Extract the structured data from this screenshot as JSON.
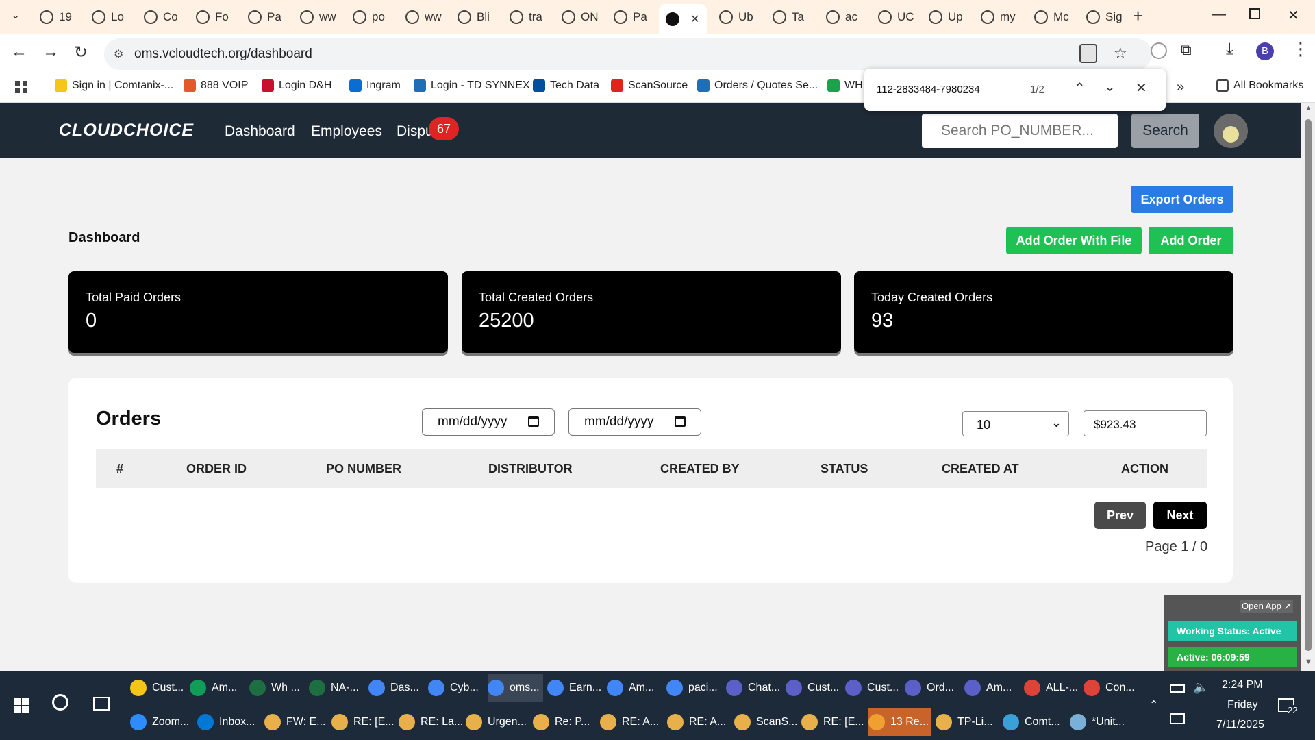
{
  "browser": {
    "tabs": [
      {
        "label": "19",
        "icon": "globe-icon"
      },
      {
        "label": "Lo",
        "icon": "globe-icon"
      },
      {
        "label": "Co",
        "icon": "logi-icon"
      },
      {
        "label": "Fo",
        "icon": "globe-icon"
      },
      {
        "label": "Pa",
        "icon": "arrow-icon"
      },
      {
        "label": "ww",
        "icon": "globe-icon"
      },
      {
        "label": "po",
        "icon": "doc-icon"
      },
      {
        "label": "ww",
        "icon": "globe-icon"
      },
      {
        "label": "Bli",
        "icon": "globe-icon"
      },
      {
        "label": "tra",
        "icon": "globe-icon"
      },
      {
        "label": "ON",
        "icon": "globe-icon"
      },
      {
        "label": "Pa",
        "icon": "cloud-icon"
      },
      {
        "label": "",
        "icon": "active-tab-icon"
      },
      {
        "label": "Ub",
        "icon": "u-icon"
      },
      {
        "label": "Ta",
        "icon": "globe-icon"
      },
      {
        "label": "ac",
        "icon": "globe-icon"
      },
      {
        "label": "UC",
        "icon": "uc-icon"
      },
      {
        "label": "Up",
        "icon": "check-icon"
      },
      {
        "label": "my",
        "icon": "globe-icon"
      },
      {
        "label": "Mc",
        "icon": "etn-icon"
      },
      {
        "label": "Sig",
        "icon": "globe-icon"
      }
    ],
    "url": "oms.vcloudtech.org/dashboard",
    "profile_initial": "B",
    "bookmarks": [
      {
        "label": "Sign in | Comtanix-...",
        "color": "#f5c518"
      },
      {
        "label": "888 VOIP",
        "color": "#e05a2a"
      },
      {
        "label": "Login D&H",
        "color": "#c8102e"
      },
      {
        "label": "Ingram",
        "color": "#0a6ed1"
      },
      {
        "label": "Login - TD SYNNEX",
        "color": "#1f6fb6"
      },
      {
        "label": "Tech Data",
        "color": "#0050a0"
      },
      {
        "label": "ScanSource",
        "color": "#e2231a"
      },
      {
        "label": "Orders / Quotes Se...",
        "color": "#1f6fb6"
      },
      {
        "label": "WH",
        "color": "#1aa34a"
      }
    ],
    "all_bookmarks": "All Bookmarks",
    "find": {
      "query": "112-2833484-7980234",
      "count": "1/2"
    }
  },
  "app": {
    "brand": "CLOUDCHOICE",
    "nav": [
      "Dashboard",
      "Employees",
      "Dispu"
    ],
    "badge": "67",
    "search_placeholder": "Search PO_NUMBER...",
    "search_label": "Search"
  },
  "dashboard": {
    "title": "Dashboard",
    "export_label": "Export Orders",
    "add_file_label": "Add Order With File",
    "add_label": "Add Order",
    "cards": [
      {
        "label": "Total Paid Orders",
        "value": "0"
      },
      {
        "label": "Total Created Orders",
        "value": "25200"
      },
      {
        "label": "Today Created Orders",
        "value": "93"
      }
    ]
  },
  "orders": {
    "title": "Orders",
    "date_placeholder": "mm/dd/yyyy",
    "page_size": "10",
    "amount": "$923.43",
    "columns": [
      "#",
      "ORDER ID",
      "PO NUMBER",
      "DISTRIBUTOR",
      "CREATED BY",
      "STATUS",
      "CREATED AT",
      "ACTION"
    ],
    "prev_label": "Prev",
    "next_label": "Next",
    "page_info": "Page 1 / 0"
  },
  "widget": {
    "open_app": "Open App ↗",
    "status": "Working Status: Active",
    "timer": "Active: 06:09:59"
  },
  "taskbar": {
    "row1": [
      {
        "label": "Cust...",
        "color": "#f5c518"
      },
      {
        "label": "Am...",
        "color": "#0f9d58"
      },
      {
        "label": "Wh ...",
        "color": "#1d6f42"
      },
      {
        "label": "NA-...",
        "color": "#1d6f42"
      },
      {
        "label": "Das...",
        "color": "#4285f4"
      },
      {
        "label": "Cyb...",
        "color": "#4285f4"
      },
      {
        "label": "oms...",
        "color": "#4285f4"
      },
      {
        "label": "Earn...",
        "color": "#4285f4"
      },
      {
        "label": "Am...",
        "color": "#4285f4"
      },
      {
        "label": "paci...",
        "color": "#4285f4"
      },
      {
        "label": "Chat...",
        "color": "#5b5fc7"
      },
      {
        "label": "Cust...",
        "color": "#5b5fc7"
      },
      {
        "label": "Cust...",
        "color": "#5b5fc7"
      },
      {
        "label": "Ord...",
        "color": "#5b5fc7"
      },
      {
        "label": "Am...",
        "color": "#5b5fc7"
      },
      {
        "label": "ALL-...",
        "color": "#db4437"
      },
      {
        "label": "Con...",
        "color": "#db4437"
      }
    ],
    "row2": [
      {
        "label": "Zoom...",
        "color": "#2d8cff"
      },
      {
        "label": "Inbox...",
        "color": "#0078d4"
      },
      {
        "label": "FW: E...",
        "color": "#e8b04a"
      },
      {
        "label": "RE: [E...",
        "color": "#e8b04a"
      },
      {
        "label": "RE: La...",
        "color": "#e8b04a"
      },
      {
        "label": "Urgen...",
        "color": "#e8b04a"
      },
      {
        "label": "Re: P...",
        "color": "#e8b04a"
      },
      {
        "label": "RE: A...",
        "color": "#e8b04a"
      },
      {
        "label": "RE: A...",
        "color": "#e8b04a"
      },
      {
        "label": "ScanS...",
        "color": "#e8b04a"
      },
      {
        "label": "RE: [E...",
        "color": "#e8b04a"
      },
      {
        "label": "13 Re...",
        "color": "#f0a030"
      },
      {
        "label": "TP-Li...",
        "color": "#e8b04a"
      },
      {
        "label": "Comt...",
        "color": "#3aa0d8"
      },
      {
        "label": "*Unit...",
        "color": "#7ab0d8"
      }
    ],
    "time": "2:24 PM",
    "day": "Friday",
    "date": "7/11/2025",
    "notifications": "22"
  }
}
